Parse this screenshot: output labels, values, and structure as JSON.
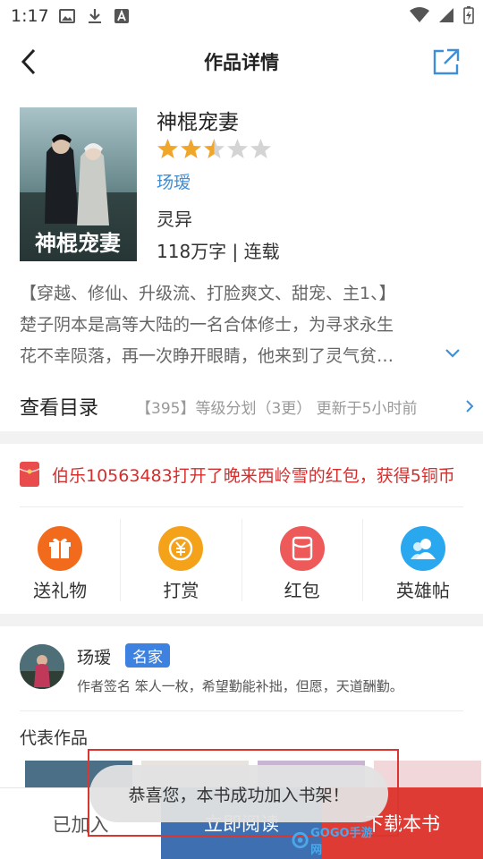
{
  "status_bar": {
    "time": "1:17"
  },
  "nav": {
    "title": "作品详情"
  },
  "book": {
    "title": "神棍宠妻",
    "rating_stars": 2.5,
    "rating_max": 5,
    "author": "玚瑷",
    "genre": "灵异",
    "meta": "118万字 | 连载",
    "description_lines": [
      "【穿越、修仙、升级流、打脸爽文、甜宠、主1、】",
      "楚子阴本是高等大陆的一名合体修士，为寻求永生",
      "花不幸陨落，再一次睁开眼睛，他来到了灵气贫…"
    ]
  },
  "catalog": {
    "label": "查看目录",
    "latest": "【395】等级分划（3更）  更新于5小时前"
  },
  "red_packet_notice": "伯乐10563483打开了晚来西岭雪的红包，获得5铜币",
  "actions": [
    {
      "label": "送礼物",
      "icon": "gift-icon",
      "color": "#f26b1d"
    },
    {
      "label": "打赏",
      "icon": "yuan-coin-icon",
      "color": "#f5a21b"
    },
    {
      "label": "红包",
      "icon": "red-packet-icon",
      "color": "#ee5a5a"
    },
    {
      "label": "英雄帖",
      "icon": "heroes-icon",
      "color": "#29a8ef"
    }
  ],
  "author_card": {
    "name": "玚瑷",
    "badge": "名家",
    "signature": "作者签名  笨人一枚，希望勤能补拙，但愿，天道酬勤。"
  },
  "representative": {
    "label": "代表作品"
  },
  "bottom_bar": {
    "added": "已加入",
    "read": "立即阅读",
    "download": "下载本书"
  },
  "toast": "恭喜您，本书成功加入书架！",
  "watermark": "GOGO手游网",
  "cover_text": "神棍宠妻",
  "colors": {
    "accent_blue": "#3f8fd8",
    "read_button": "#3e6fb0",
    "download_button": "#de3b34",
    "notice_red": "#d62d2d",
    "star": "#f0a52b"
  }
}
